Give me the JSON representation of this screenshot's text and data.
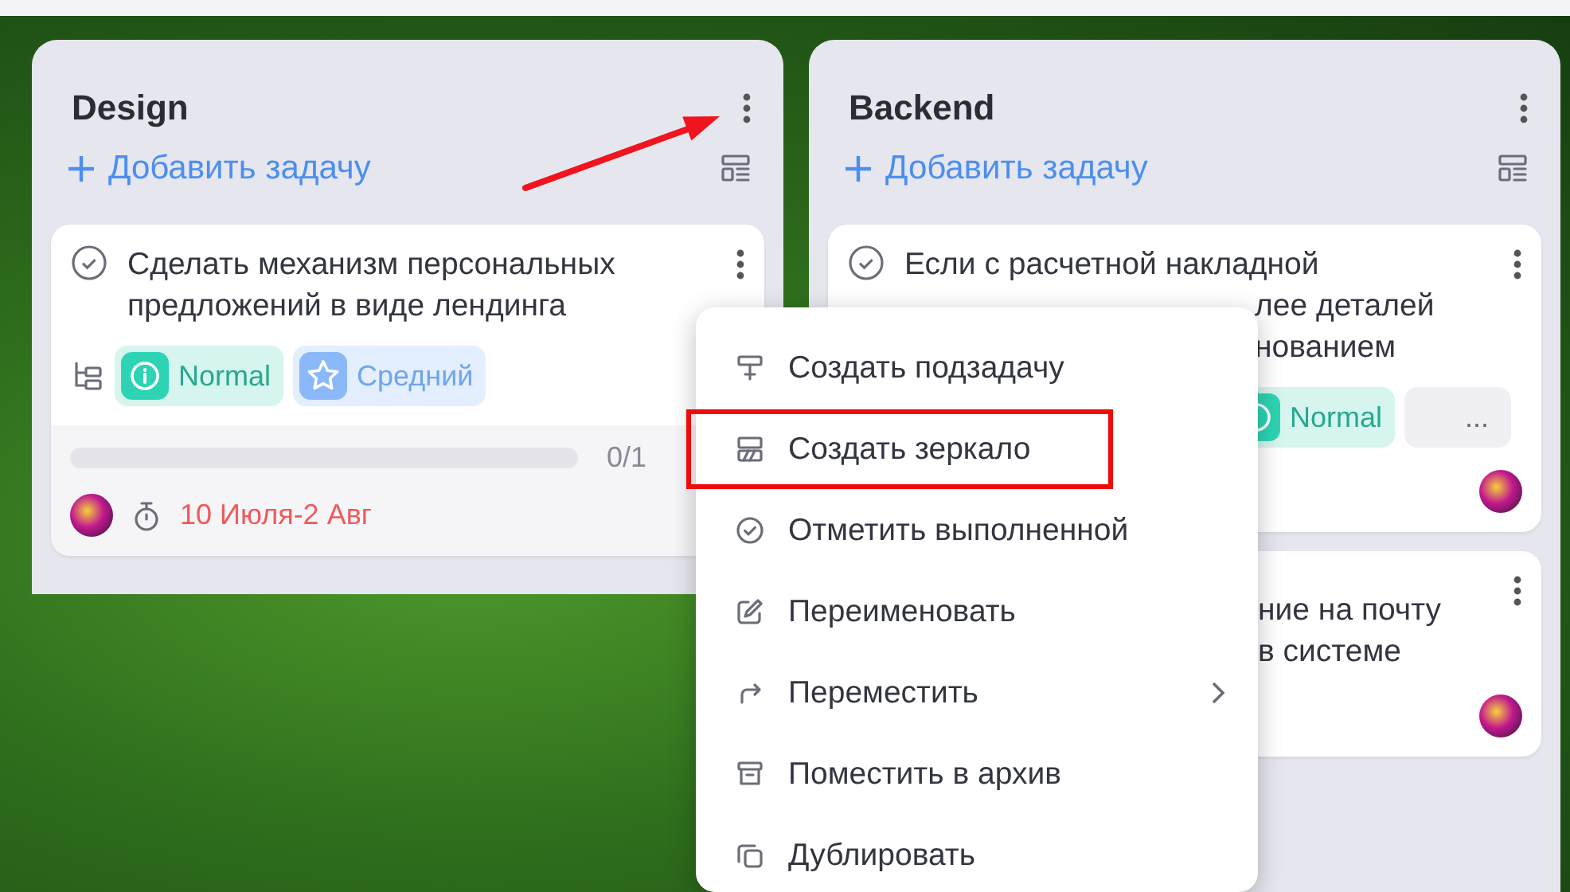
{
  "columns": [
    {
      "title": "Design",
      "add_task": "Добавить задачу",
      "cards": [
        {
          "title_lines": [
            "Сделать механизм персональных",
            "предложений в виде лендинга"
          ],
          "tags": [
            {
              "kind": "status",
              "label": "Normal"
            },
            {
              "kind": "priority",
              "label": "Средний"
            }
          ],
          "progress": {
            "level": 0,
            "count": "0/1"
          },
          "date": "10 Июля-2 Авг",
          "overdue": true
        }
      ]
    },
    {
      "title": "Backend",
      "add_task": "Добавить задачу",
      "cards": [
        {
          "title_lines": [
            "Если с расчетной накладной"
          ],
          "fragments": [
            "лее деталей",
            "нованием"
          ],
          "tags": [
            {
              "kind": "status",
              "label": "Normal"
            },
            {
              "kind": "more",
              "label": "..."
            }
          ]
        },
        {
          "fragments": [
            "ние на почту",
            "в системе"
          ]
        }
      ]
    }
  ],
  "menu": {
    "items": [
      {
        "label": "Создать подзадачу",
        "submenu": false,
        "annotated": false
      },
      {
        "label": "Создать зеркало",
        "submenu": false,
        "annotated": true
      },
      {
        "label": "Отметить выполненной",
        "submenu": false,
        "annotated": false
      },
      {
        "label": "Переименовать",
        "submenu": false,
        "annotated": false
      },
      {
        "label": "Переместить",
        "submenu": true,
        "annotated": false
      },
      {
        "label": "Поместить в архив",
        "submenu": false,
        "annotated": false
      },
      {
        "label": "Дублировать",
        "submenu": false,
        "annotated": false
      }
    ]
  }
}
